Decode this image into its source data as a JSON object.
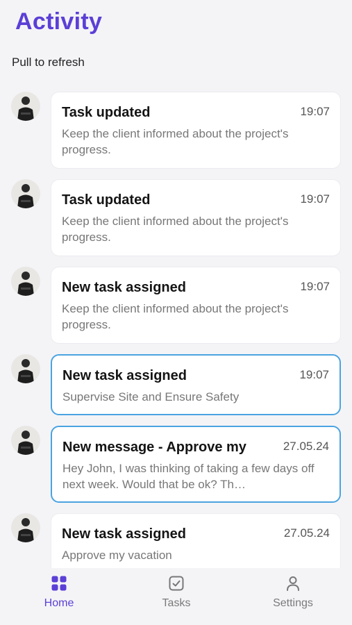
{
  "header": {
    "title": "Activity",
    "pull_hint": "Pull to refresh"
  },
  "activities": [
    {
      "title": "Task updated",
      "time": "19:07",
      "body": "Keep the client informed about the project's progress.",
      "highlighted": false
    },
    {
      "title": "Task updated",
      "time": "19:07",
      "body": "Keep the client informed about the project's progress.",
      "highlighted": false
    },
    {
      "title": "New task assigned",
      "time": "19:07",
      "body": "Keep the client informed about the project's progress.",
      "highlighted": false
    },
    {
      "title": "New task assigned",
      "time": "19:07",
      "body": "Supervise Site and Ensure Safety",
      "highlighted": true
    },
    {
      "title": "New message - Approve my",
      "time": "27.05.24",
      "body": "Hey John, I was thinking of taking a few days off next week. Would that be ok? Th…",
      "highlighted": true
    },
    {
      "title": "New task assigned",
      "time": "27.05.24",
      "body": "Approve my vacation",
      "highlighted": false
    }
  ],
  "nav": {
    "items": [
      {
        "label": "Home",
        "icon": "grid-icon",
        "active": true
      },
      {
        "label": "Tasks",
        "icon": "checkbox-icon",
        "active": false
      },
      {
        "label": "Settings",
        "icon": "person-icon",
        "active": false
      }
    ]
  },
  "colors": {
    "accent": "#5b3fd6",
    "highlight_border": "#4aa3e0",
    "background": "#f4f4f7"
  }
}
